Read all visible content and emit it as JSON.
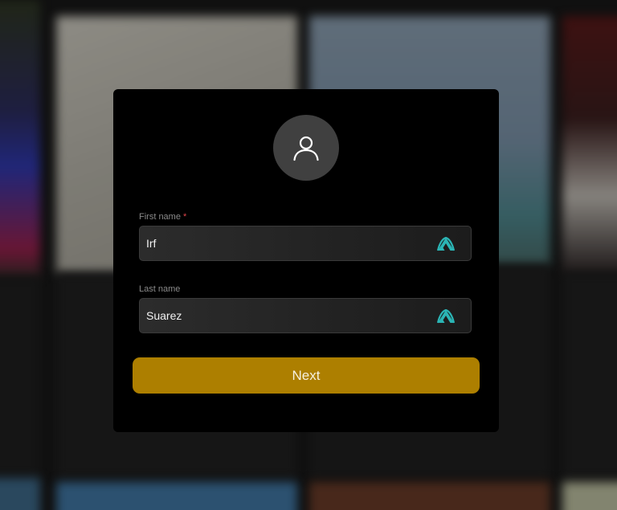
{
  "form": {
    "first_name_label": "First name",
    "required_marker": "*",
    "first_name_value": "Irf",
    "last_name_label": "Last name",
    "last_name_value": "Suarez",
    "next_label": "Next"
  },
  "icons": {
    "avatar": "user-icon",
    "autofill": "nordpass-autofill-icon"
  },
  "colors": {
    "modal_background": "#000000",
    "avatar_background": "#404040",
    "field_background": "#252525",
    "field_border": "#3a3a3a",
    "label_text": "#8a8a8a",
    "required_marker": "#e0444a",
    "autofill_icon": "#2bb5b5",
    "next_button": "#ad7f00",
    "next_button_text": "#f6f0e0"
  }
}
